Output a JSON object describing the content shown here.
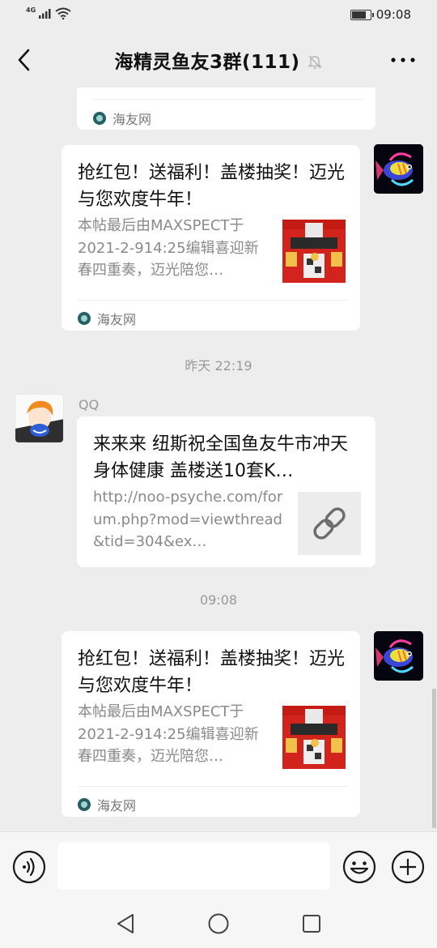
{
  "status_bar": {
    "network": "4G",
    "time": "09:08",
    "battery_level": 0.7
  },
  "header": {
    "title": "海精灵鱼友3群(111)",
    "back_icon": "chevron-left-icon",
    "mute_icon": "bell-off-icon",
    "more_icon": "more-dots-icon"
  },
  "messages": [
    {
      "type": "link-card-partial",
      "source": "海友网",
      "from_me": true
    },
    {
      "type": "link-card",
      "from_me": true,
      "title": "抢红包！送福利！盖楼抽奖！迈光与您欢度牛年！",
      "description": "本帖最后由MAXSPECT于2021-2-914:25编辑喜迎新春四重奏，迈光陪您…",
      "source": "海友网"
    },
    {
      "type": "timestamp",
      "text": "昨天 22:19"
    },
    {
      "type": "link-card",
      "from_me": false,
      "sender": "QQ",
      "title": "来来来 纽斯祝全国鱼友牛市冲天 身体健康 盖楼送10套K…",
      "description": "http://noo-psyche.com/forum.php?mod=viewthread&tid=304&ex…",
      "thumbnail_icon": "link-icon"
    },
    {
      "type": "timestamp",
      "text": "09:08"
    },
    {
      "type": "link-card",
      "from_me": true,
      "title": "抢红包！送福利！盖楼抽奖！迈光与您欢度牛年！",
      "description": "本帖最后由MAXSPECT于2021-2-914:25编辑喜迎新春四重奏，迈光陪您…",
      "source": "海友网"
    }
  ],
  "input_bar": {
    "voice_icon": "voice-icon",
    "input_value": "",
    "emoji_icon": "emoji-icon",
    "plus_icon": "plus-icon"
  },
  "nav_bar": {
    "back_icon": "triangle-back-icon",
    "home_icon": "circle-home-icon",
    "recent_icon": "square-recent-icon"
  },
  "colors": {
    "background": "#ededed",
    "bubble": "#ffffff",
    "gray_text": "#8a8a8a",
    "red_thumbnail": "#d2241c"
  }
}
